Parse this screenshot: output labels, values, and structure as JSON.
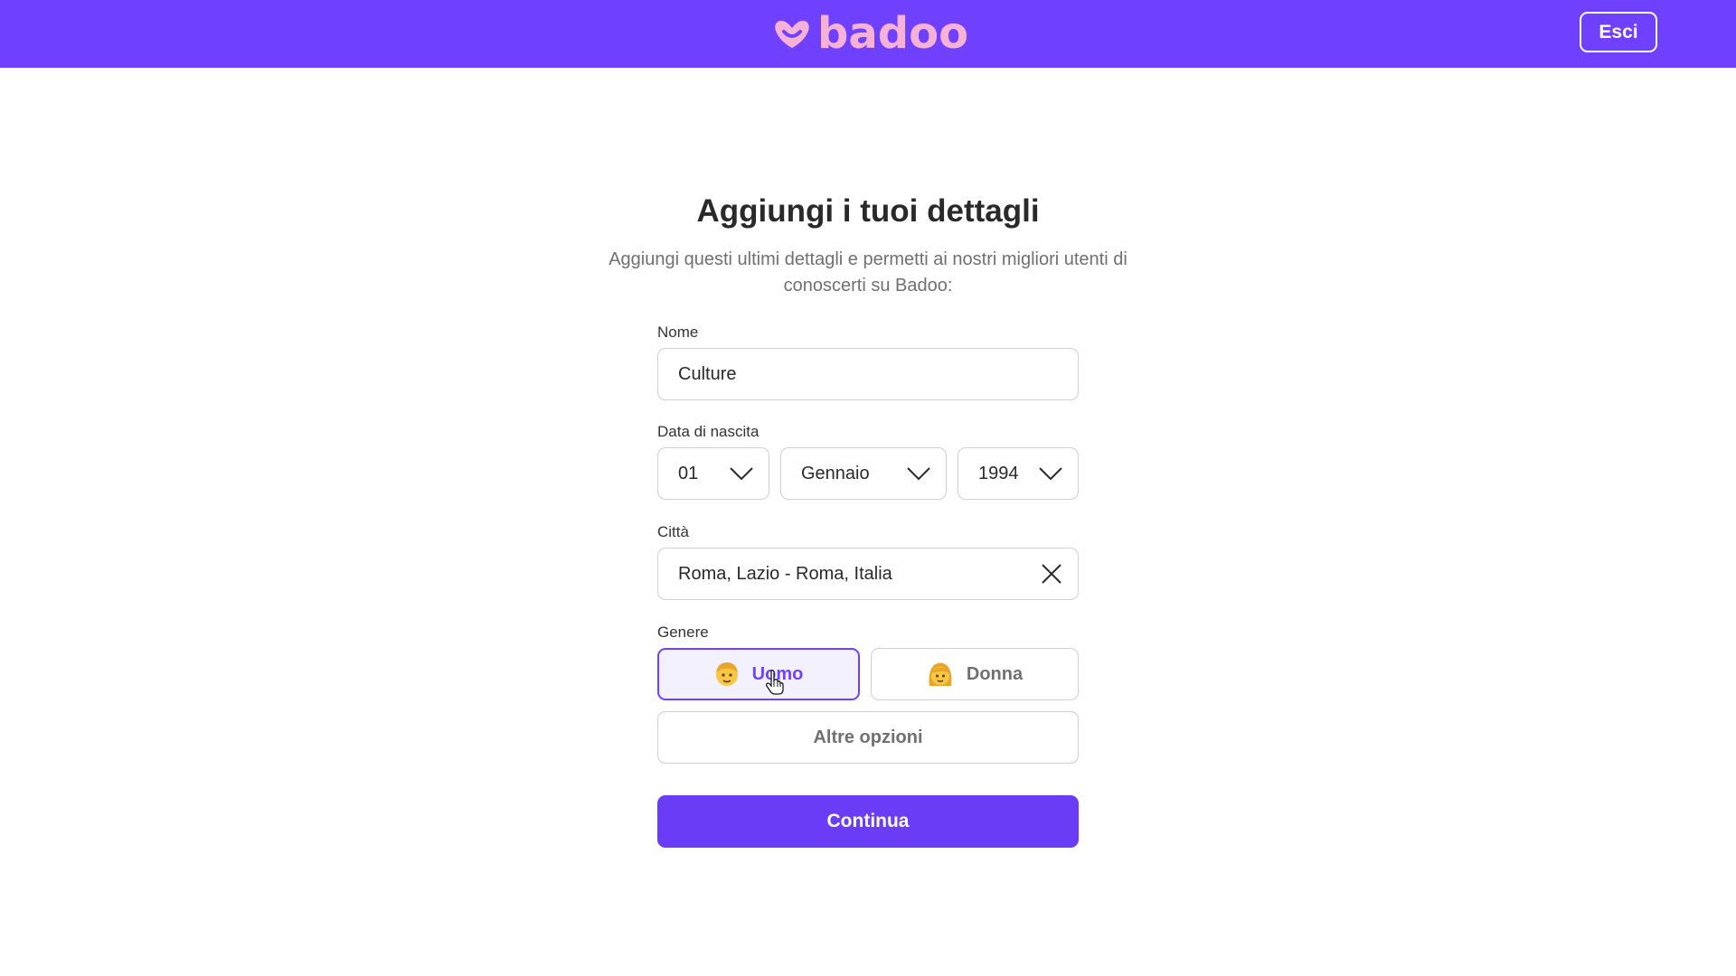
{
  "header": {
    "logo_text": "badoo",
    "logout_label": "Esci",
    "brand_color": "#7040ff",
    "logo_color": "#f6b1d7"
  },
  "form": {
    "title": "Aggiungi i tuoi dettagli",
    "subtitle": "Aggiungi questi ultimi dettagli e permetti ai nostri migliori utenti di conoscerti su Badoo:",
    "name": {
      "label": "Nome",
      "value": "Culture"
    },
    "birthdate": {
      "label": "Data di nascita",
      "day": "01",
      "month": "Gennaio",
      "year": "1994"
    },
    "city": {
      "label": "Città",
      "value": "Roma, Lazio - Roma, Italia"
    },
    "gender": {
      "label": "Genere",
      "options": [
        {
          "label": "Uomo",
          "icon": "man-emoji-icon",
          "selected": true
        },
        {
          "label": "Donna",
          "icon": "woman-emoji-icon",
          "selected": false
        }
      ],
      "other_label": "Altre opzioni"
    },
    "submit_label": "Continua"
  }
}
